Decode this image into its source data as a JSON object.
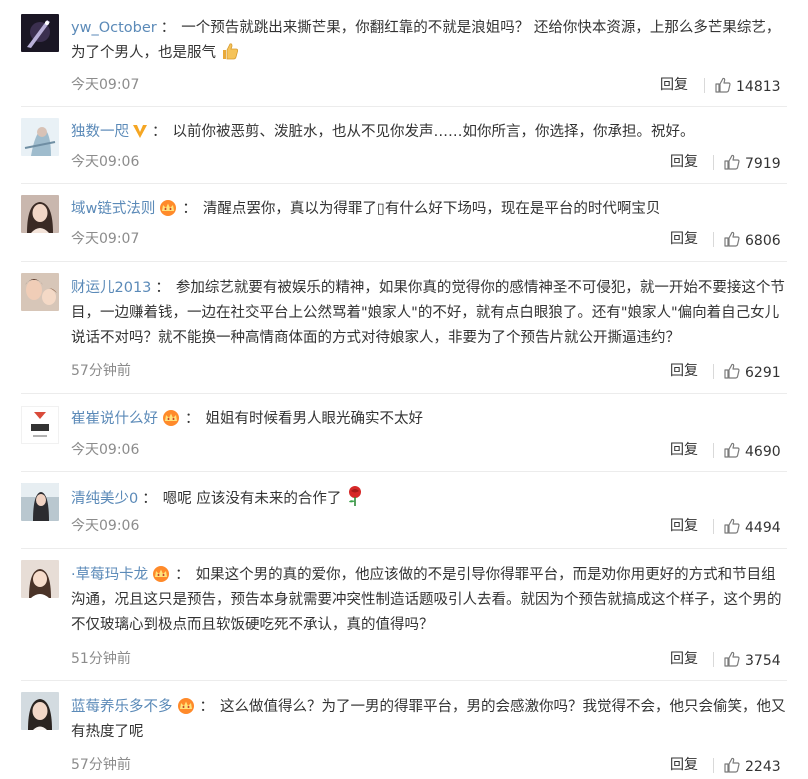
{
  "reply_label": "回复",
  "comments": [
    {
      "user": "yw_October",
      "text": "一个预告就跳出来撕芒果，你翻红靠的不就是浪姐吗？ 还给你快本资源，上那么多芒果综艺，为了个男人，也是服气",
      "emoji": "thumbs-up-icon",
      "time": "今天09:07",
      "likes": "14813"
    },
    {
      "user": "独数一咫",
      "badge": "vip-v-icon",
      "text": "以前你被恶剪、泼脏水，也从不见你发声……如你所言，你选择，你承担。祝好。",
      "time": "今天09:06",
      "likes": "7919"
    },
    {
      "user": "域w链式法则",
      "badge": "crown-icon",
      "text": "清醒点罢你，真以为得罪了▯有什么好下场吗，现在是平台的时代啊宝贝",
      "time": "今天09:07",
      "likes": "6806"
    },
    {
      "user": "财运儿2013",
      "text": "参加综艺就要有被娱乐的精神，如果你真的觉得你的感情神圣不可侵犯，就一开始不要接这个节目，一边赚着钱，一边在社交平台上公然骂着\"娘家人\"的不好，就有点白眼狼了。还有\"娘家人\"偏向着自己女儿说话不对吗？就不能换一种高情商体面的方式对待娘家人，非要为了个预告片就公开撕逼违约？",
      "time": "57分钟前",
      "likes": "6291"
    },
    {
      "user": "崔崔说什么好",
      "badge": "crown-icon",
      "text": "姐姐有时候看男人眼光确实不太好",
      "time": "今天09:06",
      "likes": "4690"
    },
    {
      "user": "清纯美少0",
      "text": "嗯呢 应该没有未来的合作了",
      "emoji": "rose-icon",
      "time": "今天09:06",
      "likes": "4494"
    },
    {
      "user": "·草莓玛卡龙",
      "badge": "crown-icon",
      "text": "如果这个男的真的爱你，他应该做的不是引导你得罪平台，而是劝你用更好的方式和节目组沟通，况且这只是预告，预告本身就需要冲突性制造话题吸引人去看。就因为个预告就搞成这个样子，这个男的不仅玻璃心到极点而且软饭硬吃死不承认，真的值得吗？",
      "time": "51分钟前",
      "likes": "3754"
    },
    {
      "user": "蓝莓养乐多不多",
      "badge": "crown-icon",
      "text": "这么做值得么？为了一男的得罪平台，男的会感激你吗？我觉得不会，他只会偷笑，他又有热度了呢",
      "time": "57分钟前",
      "likes": "2243"
    }
  ]
}
